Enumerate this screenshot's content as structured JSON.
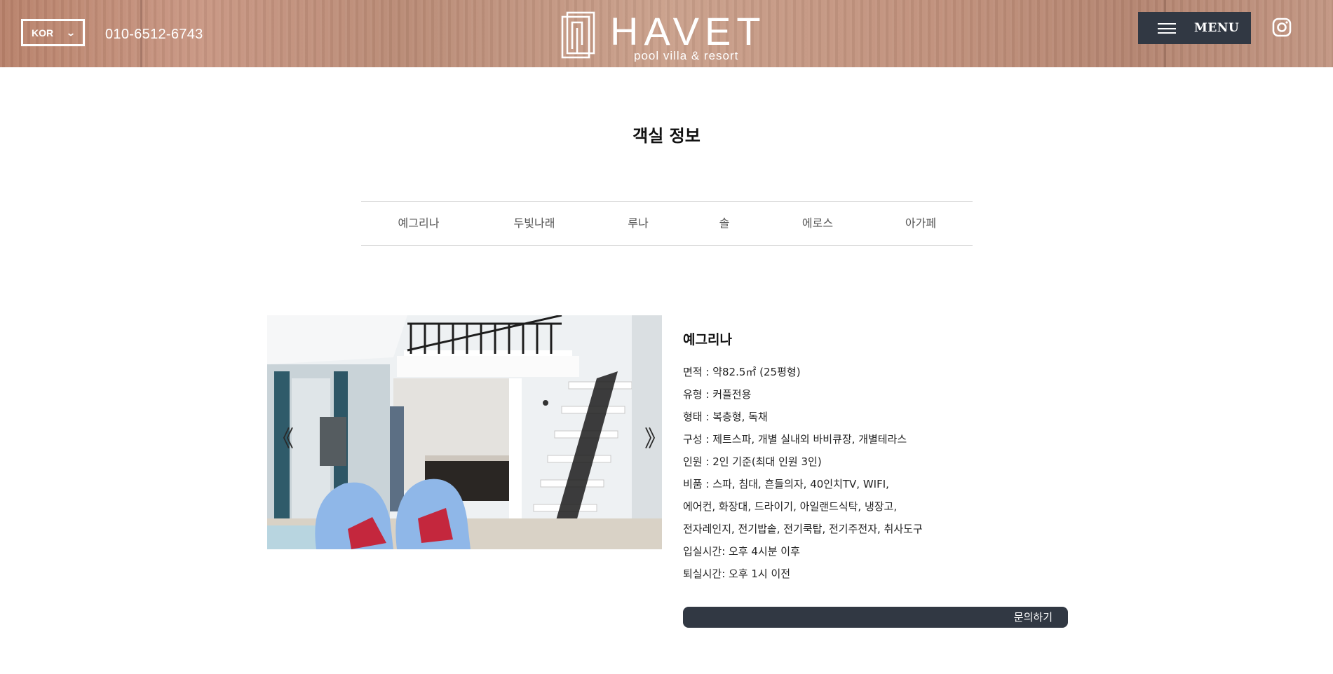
{
  "header": {
    "language": "KOR",
    "phone": "010-6512-6743",
    "logo_title": "HAVET",
    "logo_subtitle": "pool villa & resort",
    "menu_label": "MENU"
  },
  "page": {
    "title": "객실 정보"
  },
  "tabs": [
    "예그리나",
    "두빛나래",
    "루나",
    "솔",
    "에로스",
    "아가페"
  ],
  "carousel": {
    "prev": "《",
    "next": "》"
  },
  "room": {
    "name": "예그리나",
    "details": [
      "면적 : 약82.5㎡ (25평형)",
      "유형 : 커플전용",
      "형태 : 복층형, 독채",
      "구성 : 제트스파, 개별 실내외 바비큐장, 개별테라스",
      "인원 : 2인 기준(최대 인원 3인)",
      "비품 : 스파, 침대, 흔들의자, 40인치TV, WIFI,",
      "에어컨, 화장대, 드라이기, 아일랜드식탁, 냉장고,",
      "전자레인지, 전기밥솥, 전기쿡탑, 전기주전자, 취사도구",
      "입실시간: 오후 4시분 이후",
      "퇴실시간: 오후 1시 이전"
    ],
    "inquiry_label": "문의하기"
  },
  "colors": {
    "dark_button": "#313843",
    "wood": "#c29682"
  }
}
